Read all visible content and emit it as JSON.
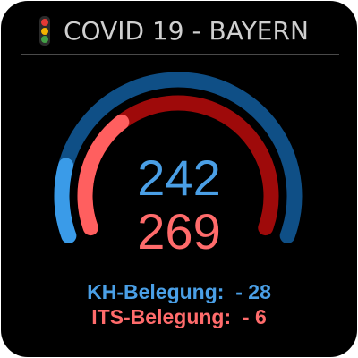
{
  "header": {
    "title": "COVID 19 - BAYERN",
    "traffic_light": {
      "icon": "traffic-light-icon",
      "colors": [
        "#e53935",
        "#f5b400",
        "#43a047"
      ]
    }
  },
  "gauge": {
    "colors": {
      "outer_track": "#0f4f86",
      "outer_fill": "#3a9be8",
      "inner_track": "#9e0a0a",
      "inner_fill": "#ff5f5f"
    },
    "outer_fill_fraction": 0.16,
    "inner_fill_fraction": 0.33
  },
  "values": {
    "primary": "242",
    "secondary": "269"
  },
  "stats": {
    "kh_line": "KH-Belegung:  - 28",
    "its_line": "ITS-Belegung:  - 6"
  }
}
